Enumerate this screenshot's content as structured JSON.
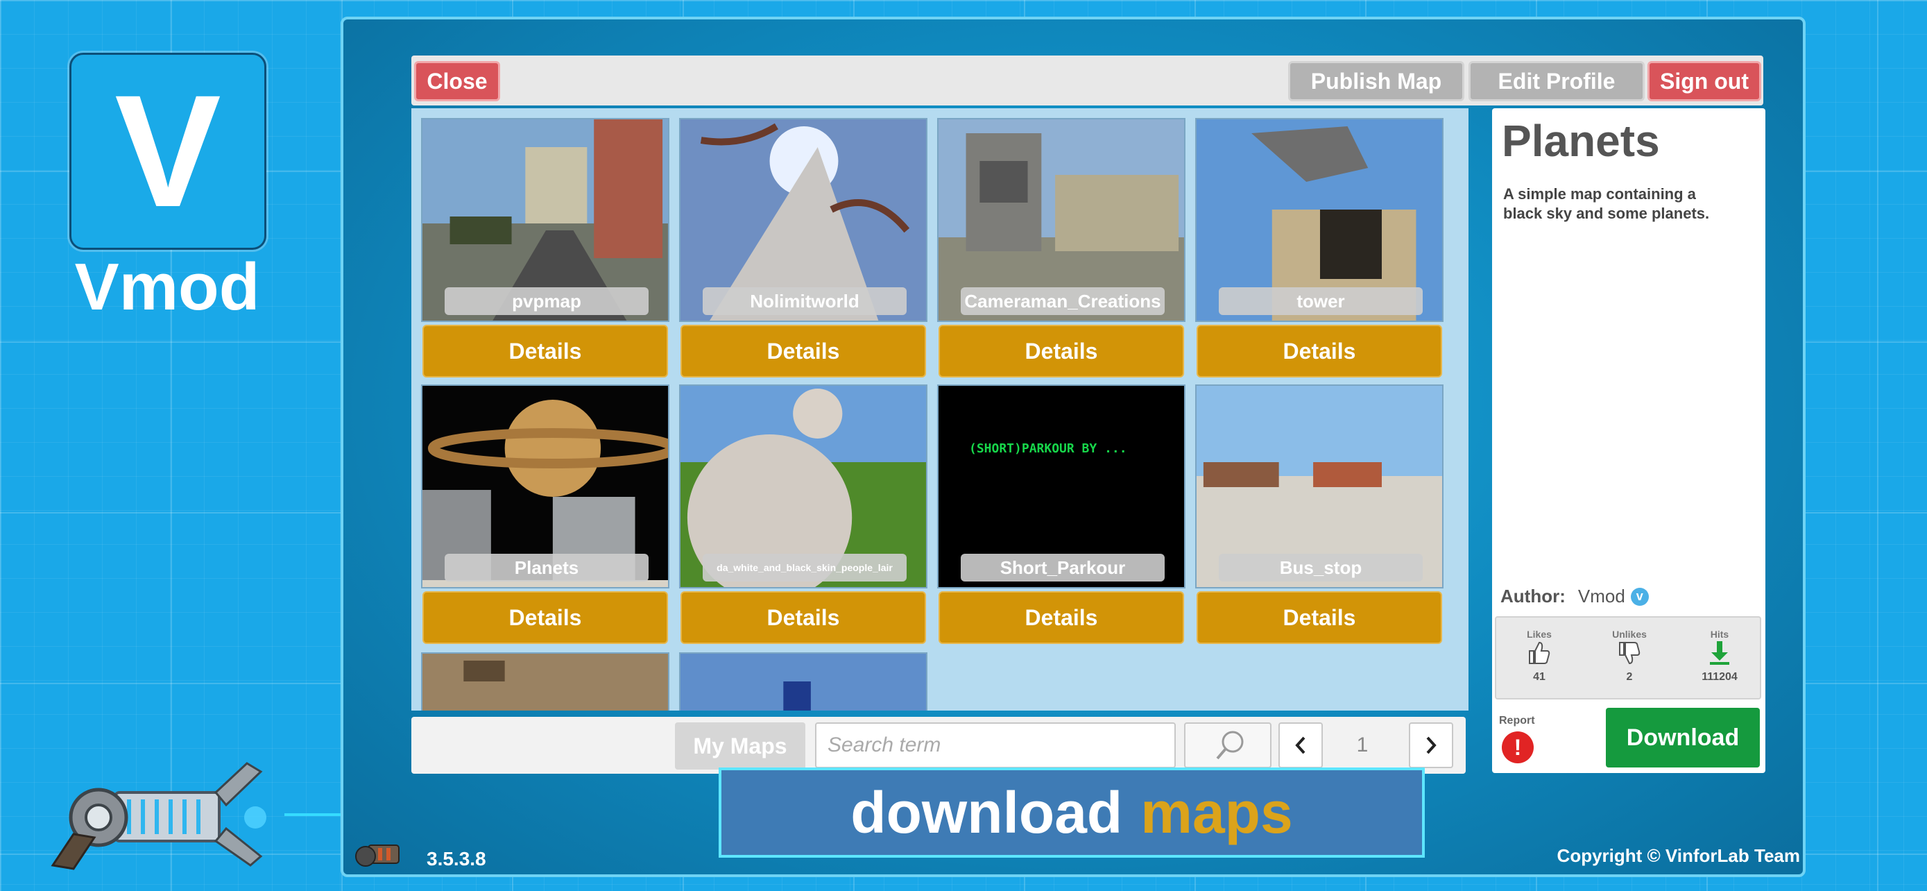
{
  "brand": {
    "logo_letter": "V",
    "name": "Vmod"
  },
  "toolbar": {
    "close_label": "Close",
    "publish_label": "Publish Map",
    "edit_profile_label": "Edit Profile",
    "sign_out_label": "Sign out"
  },
  "maps": [
    {
      "name": "pvpmap",
      "details_label": "Details"
    },
    {
      "name": "Nolimitworld",
      "details_label": "Details"
    },
    {
      "name": "Cameraman_Creations",
      "details_label": "Details"
    },
    {
      "name": "tower",
      "details_label": "Details"
    },
    {
      "name": "Planets",
      "details_label": "Details"
    },
    {
      "name": "da_white_and_black_skin_people_lair",
      "details_label": "Details"
    },
    {
      "name": "Short_Parkour",
      "details_label": "Details",
      "preview_text": "(SHORT)PARKOUR BY ..."
    },
    {
      "name": "Bus_stop",
      "details_label": "Details"
    }
  ],
  "bottom_bar": {
    "my_maps_label": "My Maps",
    "search_placeholder": "Search term",
    "page_number": "1",
    "prev_icon": "chevron-left-icon",
    "next_icon": "chevron-right-icon",
    "search_icon": "magnifier-icon"
  },
  "detail": {
    "title": "Planets",
    "description": "A simple map containing a black sky and some planets.",
    "author_label": "Author:",
    "author_name": "Vmod",
    "likes_label": "Likes",
    "likes_value": "41",
    "unlikes_label": "Unlikes",
    "unlikes_value": "2",
    "hits_label": "Hits",
    "hits_value": "111204",
    "report_label": "Report",
    "download_label": "Download"
  },
  "banner": {
    "text_main": "download",
    "text_highlight": "maps"
  },
  "footer": {
    "version": "3.5.3.8",
    "copyright": "Copyright © VinforLab Team"
  },
  "colors": {
    "background": "#1aa8e8",
    "close_red": "#d9545a",
    "details_orange": "#d29407",
    "download_green": "#159a3e",
    "highlight_gold": "#dba31b",
    "banner_border": "#5ee6ff"
  }
}
